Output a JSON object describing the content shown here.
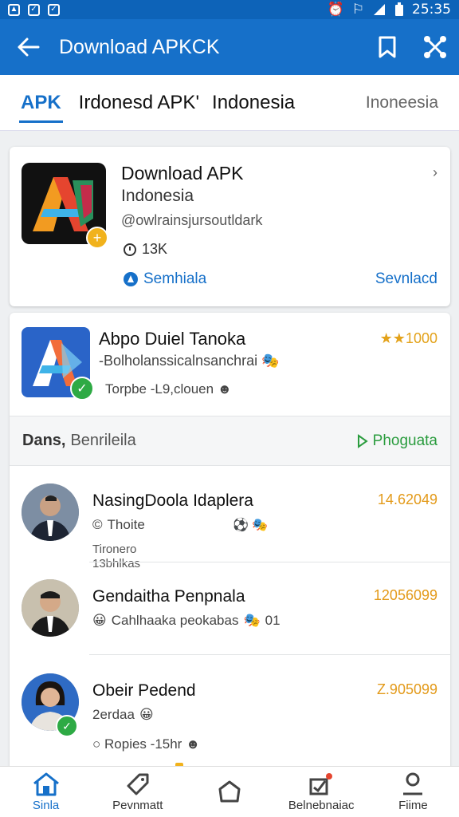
{
  "status_bar": {
    "time": "25:35",
    "icons": [
      "screenshot-icon",
      "check-icon",
      "check-icon",
      "alarm-icon",
      "wifi-icon",
      "signal-icon",
      "battery-icon"
    ]
  },
  "app_bar": {
    "title": "Download APKCK",
    "icons": [
      "back-arrow-icon",
      "bookmark-icon",
      "share-icon"
    ]
  },
  "tabs": [
    {
      "label": "APK",
      "active": true
    },
    {
      "label": "Irdonesd APK'",
      "active": false
    },
    {
      "label": "Indonesia",
      "active": false
    },
    {
      "label": "Inoneesia",
      "active": false
    }
  ],
  "featured": {
    "title": "Download APK",
    "subtitle": "Indonesia",
    "handle": "@owlrainsjursoutldark",
    "downloads": "13K",
    "link_left": "Semhiala",
    "link_right": "Sevnlacd"
  },
  "app": {
    "name": "Abpo Duiel Tanoka",
    "description": "-Bolholanssicalnsanchrai",
    "meta": "Torpbe -L9,clouen",
    "rating": "★★1000"
  },
  "section": {
    "title": "Dans,",
    "subtitle": "Benrileila",
    "action": "Phoguata"
  },
  "people": [
    {
      "name": "NasingDoola Idaplera",
      "sub": "Thoite",
      "extra1": "Tironero",
      "extra2": "13bhlkas",
      "value": "14.62049",
      "verified": false
    },
    {
      "name": "Gendaitha Penpnala",
      "sub": "Cahlhaaka peokabas",
      "extra_num": "01",
      "value": "12056099",
      "verified": false
    },
    {
      "name": "Obeir Pedend",
      "sub": "2erdaa",
      "sub2": "Ropies -15hr",
      "value": "Z.905099",
      "verified": true
    }
  ],
  "bottom_nav": [
    {
      "label": "Sinla",
      "icon": "home-icon",
      "active": true
    },
    {
      "label": "Pevnmatt",
      "icon": "tag-icon",
      "active": false
    },
    {
      "label": "",
      "icon": "pentagon-icon",
      "active": false
    },
    {
      "label": "Belnebnaiac",
      "icon": "notification-icon",
      "active": false
    },
    {
      "label": "Fiime",
      "icon": "profile-icon",
      "active": false
    }
  ]
}
